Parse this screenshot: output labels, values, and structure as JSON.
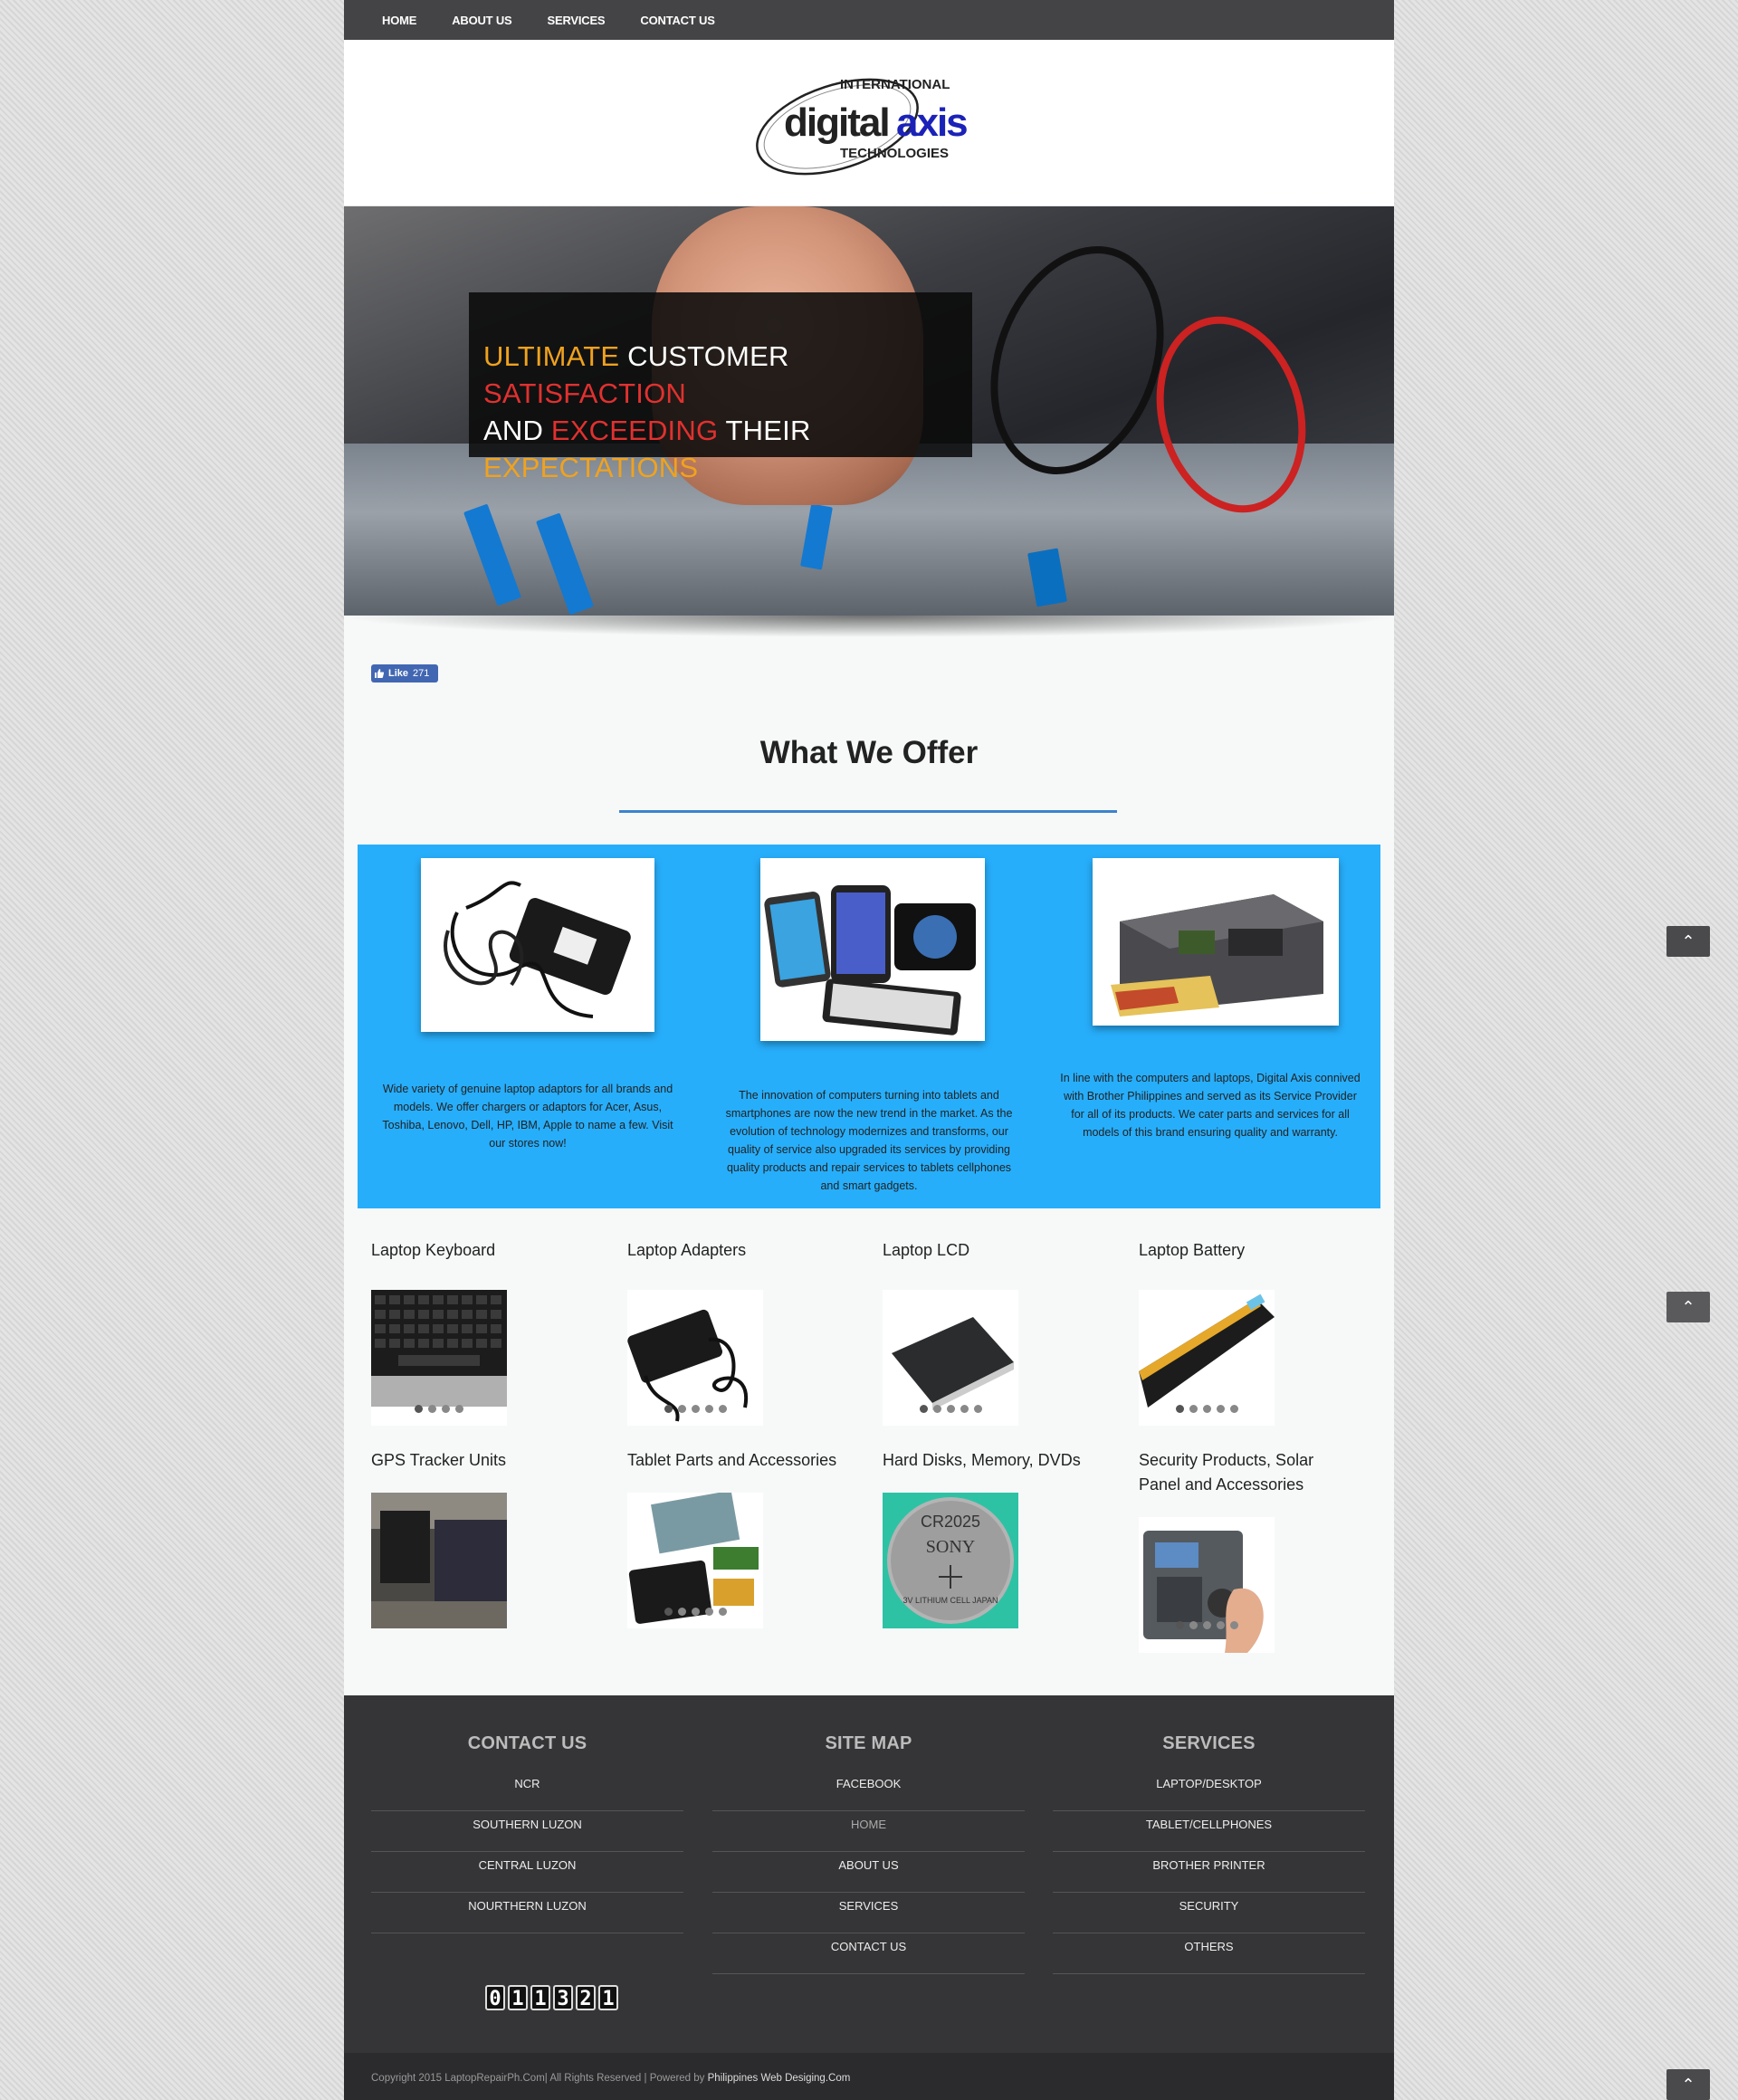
{
  "nav": [
    "HOME",
    "ABOUT US",
    "SERVICES",
    "CONTACT US"
  ],
  "logo": {
    "top": "INTERNATIONAL",
    "word1": "digital",
    "word2": "axis",
    "bottom": "TECHNOLOGIES"
  },
  "hero": {
    "line1": [
      {
        "t": "ULTIMATE ",
        "c": "or"
      },
      {
        "t": "CUSTOMER ",
        "c": "wh"
      },
      {
        "t": "SATISFACTION",
        "c": "rd"
      }
    ],
    "line2": [
      {
        "t": "AND ",
        "c": "wh"
      },
      {
        "t": "EXCEEDING ",
        "c": "rd"
      },
      {
        "t": "THEIR ",
        "c": "wh"
      },
      {
        "t": "EXPECTATIONS",
        "c": "or"
      }
    ]
  },
  "fb_like": {
    "label": "Like",
    "count": "271"
  },
  "what_we_offer": {
    "title": "What We Offer",
    "cards": [
      {
        "image": "laptop-adapter",
        "text": "Wide variety of genuine laptop adaptors for all brands and models. We offer chargers or adaptors for Acer, Asus, Toshiba, Lenovo, Dell, HP, IBM, Apple to name a few. Visit our stores now!"
      },
      {
        "image": "tablets",
        "text": "The innovation of computers turning into tablets and smartphones are now the new trend in the market. As the evolution of technology modernizes and transforms, our quality of service also upgraded its services by providing quality products and repair services to tablets cellphones and smart gadgets."
      },
      {
        "image": "brother-printer",
        "text": "In line with the computers and laptops, Digital Axis connived with Brother Philippines and served as its Service Provider for all of its products. We cater parts and services for all models of this brand ensuring quality and warranty."
      }
    ]
  },
  "products": [
    {
      "title": "Laptop Keyboard",
      "image": "keyboard"
    },
    {
      "title": "Laptop Adapters",
      "image": "adapter"
    },
    {
      "title": "Laptop LCD",
      "image": "lcd"
    },
    {
      "title": "Laptop Battery",
      "image": "battery"
    },
    {
      "title": "GPS Tracker Units",
      "image": "gps"
    },
    {
      "title": "Tablet Parts and Accessories",
      "image": "tablet-parts"
    },
    {
      "title": "Hard Disks, Memory, DVDs",
      "image": "coin-battery",
      "overlay": [
        "CR2025",
        "SONY",
        "3V LITHIUM CELL JAPAN"
      ]
    },
    {
      "title": "Security Products, Solar Panel and Accessories",
      "image": "biometric"
    }
  ],
  "footer": {
    "contact": {
      "title": "CONTACT US",
      "items": [
        "NCR",
        "SOUTHERN LUZON",
        "CENTRAL LUZON",
        "NOURTHERN LUZON"
      ]
    },
    "sitemap": {
      "title": "SITE MAP",
      "items": [
        "FACEBOOK",
        "HOME",
        "ABOUT US",
        "SERVICES",
        "CONTACT US"
      ]
    },
    "services": {
      "title": "SERVICES",
      "items": [
        "LAPTOP/DESKTOP",
        "TABLET/CELLPHONES",
        "BROTHER PRINTER",
        "SECURITY",
        "OTHERS"
      ]
    },
    "counter": [
      "0",
      "1",
      "1",
      "3",
      "2",
      "1"
    ]
  },
  "copyright": {
    "text": "Copyright 2015 LaptopRepairPh.Com| All Rights Reserved | Powered by ",
    "link": "Philippines Web Desiging.Com"
  },
  "scroll_top_icon": "chevron-up-icon",
  "colors": {
    "offer_bg": "#27aefb",
    "accent_line": "#3c84cd",
    "nav_bg": "#444446",
    "footer_bg": "#353537"
  }
}
